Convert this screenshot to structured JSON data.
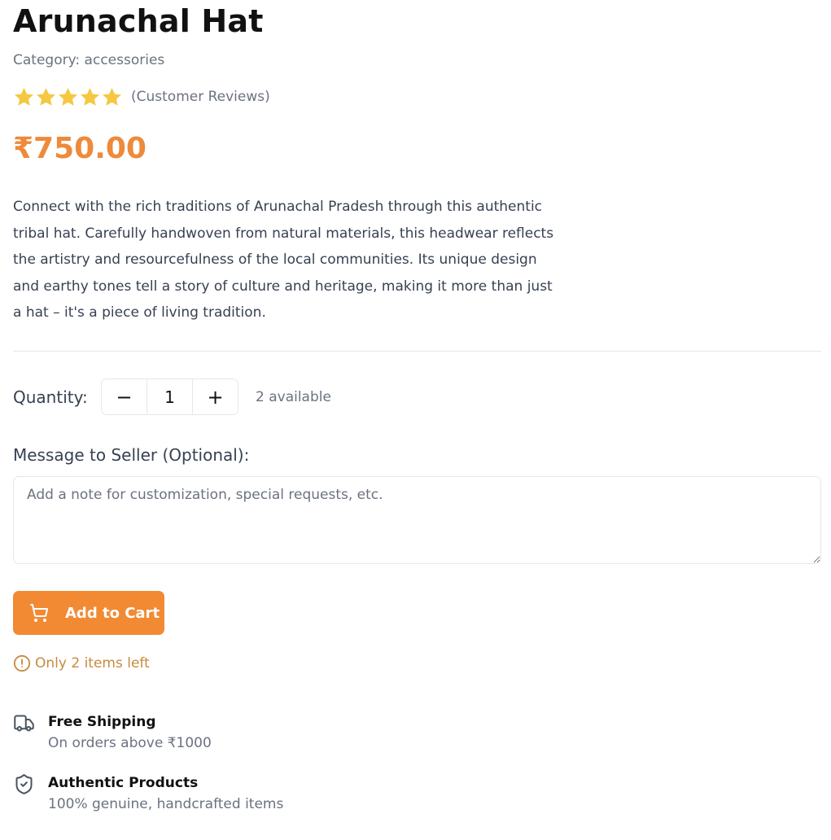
{
  "product": {
    "title": "Arunachal Hat",
    "category": "Category: accessories",
    "rating": {
      "stars_filled": 5,
      "stars_total": 5,
      "reviews_label": "(Customer Reviews)"
    },
    "price": "₹750.00",
    "description": "Connect with the rich traditions of Arunachal Pradesh through this authentic tribal hat. Carefully handwoven from natural materials, this headwear reflects the artistry and resourcefulness of the local communities. Its unique design and earthy tones tell a story of culture and heritage, making it more than just a hat – it's a piece of living tradition."
  },
  "quantity": {
    "label": "Quantity:",
    "decrement_label": "−",
    "value": "1",
    "increment_label": "+",
    "available": "2 available"
  },
  "message": {
    "label": "Message to Seller (Optional):",
    "placeholder": "Add a note for customization, special requests, etc.",
    "value": ""
  },
  "cart": {
    "button_label": "Add to Cart",
    "icon": "cart-icon"
  },
  "stock": {
    "warning": "Only 2 items left",
    "icon": "alert-circle-icon"
  },
  "features": {
    "shipping": {
      "title": "Free Shipping",
      "subtitle": "On orders above ₹1000",
      "icon": "truck-icon"
    },
    "authentic": {
      "title": "Authentic Products",
      "subtitle": "100% genuine, handcrafted items",
      "icon": "shield-check-icon"
    }
  },
  "colors": {
    "accent": "#f28a34",
    "price": "#ee8a3a",
    "star": "#f5c842",
    "warning": "#c88a3e",
    "muted_text": "#6b7280",
    "border": "#e5e7eb"
  }
}
